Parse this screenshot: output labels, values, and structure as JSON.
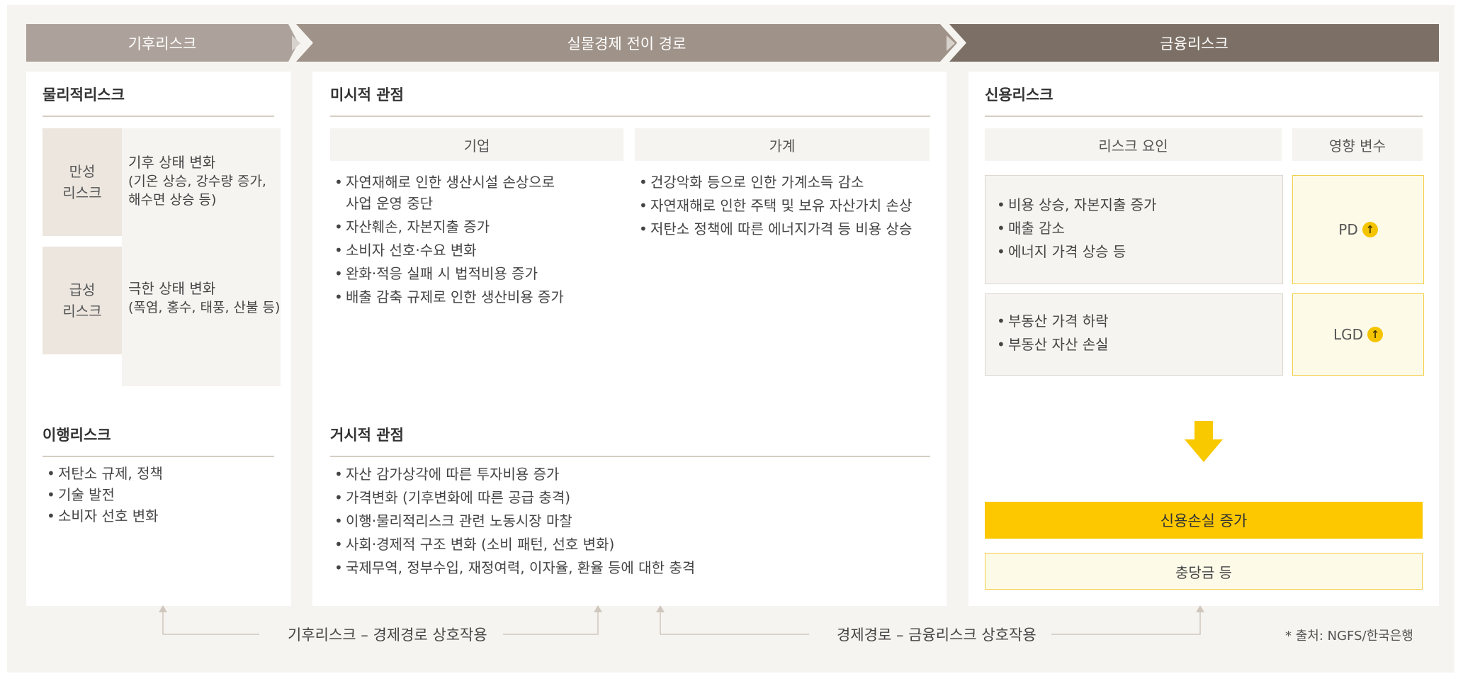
{
  "header": {
    "stage1": "기후리스크",
    "stage2": "실물경제 전이 경로",
    "stage3": "금융리스크"
  },
  "climate": {
    "physical": {
      "title": "물리적리스크",
      "items": [
        {
          "tag_line1": "만성",
          "tag_line2": "리스크",
          "main": "기후 상태 변화",
          "sub_line1": "(기온 상승, 강수량 증가,",
          "sub_line2": "해수면 상승 등)"
        },
        {
          "tag_line1": "급성",
          "tag_line2": "리스크",
          "main": "극한 상태 변화",
          "sub_line1": "(폭염, 홍수, 태풍, 산불 등)",
          "sub_line2": ""
        }
      ]
    },
    "transition": {
      "title": "이행리스크",
      "items": [
        "저탄소 규제, 정책",
        "기술 발전",
        "소비자 선호 변화"
      ]
    }
  },
  "economy": {
    "micro": {
      "title": "미시적 관점",
      "firm": {
        "label": "기업",
        "items": [
          {
            "line1": "자연재해로 인한 생산시설 손상으로",
            "line2": "사업 운영 중단"
          },
          {
            "line1": "자산훼손, 자본지출 증가",
            "line2": ""
          },
          {
            "line1": "소비자 선호·수요 변화",
            "line2": ""
          },
          {
            "line1": "완화·적응 실패 시 법적비용 증가",
            "line2": ""
          },
          {
            "line1": "배출 감축 규제로 인한 생산비용 증가",
            "line2": ""
          }
        ]
      },
      "household": {
        "label": "가계",
        "items": [
          "건강악화 등으로 인한 가계소득 감소",
          "자연재해로 인한 주택 및 보유 자산가치 손상",
          "저탄소 정책에 따른 에너지가격 등 비용 상승"
        ]
      }
    },
    "macro": {
      "title": "거시적 관점",
      "items": [
        "자산 감가상각에 따른 투자비용 증가",
        "가격변화 (기후변화에 따른 공급 충격)",
        "이행·물리적리스크 관련 노동시장 마찰",
        "사회·경제적 구조 변화 (소비 패턴, 선호 변화)",
        "국제무역, 정부수입, 재정여력, 이자율, 환율 등에 대한 충격"
      ]
    }
  },
  "finance": {
    "title": "신용리스크",
    "factor_header": "리스크 요인",
    "variable_header": "영향 변수",
    "rows": [
      {
        "factors": [
          "비용 상승, 자본지출 증가",
          "매출 감소",
          "에너지 가격 상승 등"
        ],
        "variable": "PD",
        "direction": "↑"
      },
      {
        "factors": [
          "부동산 가격 하락",
          "부동산 자산 손실"
        ],
        "variable": "LGD",
        "direction": "↑"
      }
    ],
    "result": "신용손실 증가",
    "result_sub": "충당금 등",
    "colors": {
      "accent": "#fdc800",
      "accent_light": "#fefae8"
    }
  },
  "footer": {
    "interaction1": "기후리스크 – 경제경로 상호작용",
    "interaction2": "경제경로 – 금융리스크 상호작용",
    "source": "* 출처: NGFS/한국은행"
  }
}
